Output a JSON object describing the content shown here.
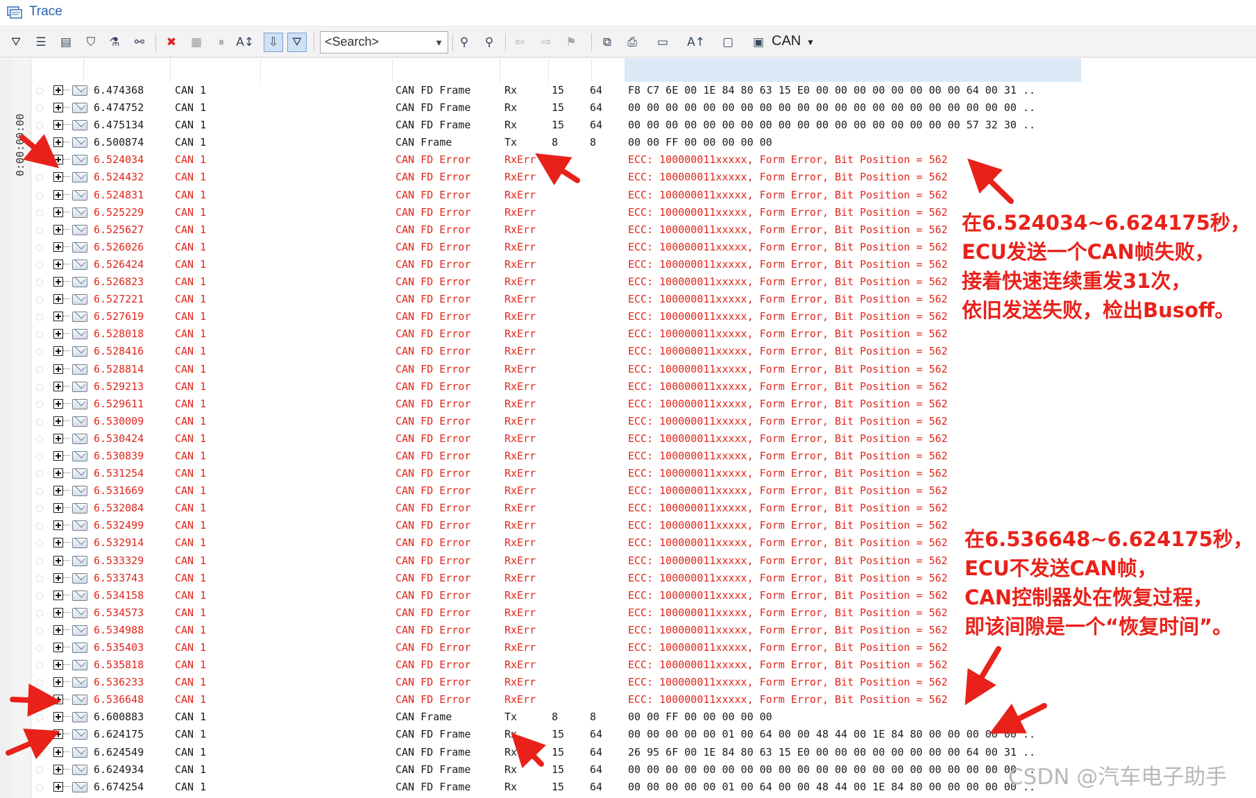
{
  "window": {
    "title": "Trace"
  },
  "toolbar": {
    "search_placeholder": "<Search>",
    "bus_label": "CAN"
  },
  "timebar": {
    "time": "0:00:00:00"
  },
  "trace_rows": [
    {
      "time": "6.474368",
      "channel": "CAN 1",
      "type": "CAN FD Frame",
      "dir": "Rx",
      "id": "15",
      "dlc": "64",
      "data": "F8 C7 6E 00 1E 84 80 63 15 E0 00 00 00 00 00 00 00 00 64 00 31  ..",
      "error": false
    },
    {
      "time": "6.474752",
      "channel": "CAN 1",
      "type": "CAN FD Frame",
      "dir": "Rx",
      "id": "15",
      "dlc": "64",
      "data": "00 00 00 00 00 00 00 00 00 00 00 00 00 00 00 00 00 00 00 00 00  ..",
      "error": false
    },
    {
      "time": "6.475134",
      "channel": "CAN 1",
      "type": "CAN FD Frame",
      "dir": "Rx",
      "id": "15",
      "dlc": "64",
      "data": "00 00 00 00 00 00 00 00 00 00 00 00 00 00 00 00 00 00 57 32 30  ..",
      "error": false
    },
    {
      "time": "6.500874",
      "channel": "CAN 1",
      "type": "CAN Frame",
      "dir": "Tx",
      "id": "8",
      "dlc": "8",
      "data": "00 00 FF 00 00 00 00 00",
      "error": false
    },
    {
      "time": "6.524034",
      "channel": "CAN 1",
      "type": "CAN FD Error",
      "dir": "RxErr",
      "id": "",
      "dlc": "",
      "data": "ECC: 100000011xxxxx, Form Error, Bit Position = 562",
      "error": true
    },
    {
      "time": "6.524432",
      "channel": "CAN 1",
      "type": "CAN FD Error",
      "dir": "RxErr",
      "id": "",
      "dlc": "",
      "data": "ECC: 100000011xxxxx, Form Error, Bit Position = 562",
      "error": true
    },
    {
      "time": "6.524831",
      "channel": "CAN 1",
      "type": "CAN FD Error",
      "dir": "RxErr",
      "id": "",
      "dlc": "",
      "data": "ECC: 100000011xxxxx, Form Error, Bit Position = 562",
      "error": true
    },
    {
      "time": "6.525229",
      "channel": "CAN 1",
      "type": "CAN FD Error",
      "dir": "RxErr",
      "id": "",
      "dlc": "",
      "data": "ECC: 100000011xxxxx, Form Error, Bit Position = 562",
      "error": true
    },
    {
      "time": "6.525627",
      "channel": "CAN 1",
      "type": "CAN FD Error",
      "dir": "RxErr",
      "id": "",
      "dlc": "",
      "data": "ECC: 100000011xxxxx, Form Error, Bit Position = 562",
      "error": true
    },
    {
      "time": "6.526026",
      "channel": "CAN 1",
      "type": "CAN FD Error",
      "dir": "RxErr",
      "id": "",
      "dlc": "",
      "data": "ECC: 100000011xxxxx, Form Error, Bit Position = 562",
      "error": true
    },
    {
      "time": "6.526424",
      "channel": "CAN 1",
      "type": "CAN FD Error",
      "dir": "RxErr",
      "id": "",
      "dlc": "",
      "data": "ECC: 100000011xxxxx, Form Error, Bit Position = 562",
      "error": true
    },
    {
      "time": "6.526823",
      "channel": "CAN 1",
      "type": "CAN FD Error",
      "dir": "RxErr",
      "id": "",
      "dlc": "",
      "data": "ECC: 100000011xxxxx, Form Error, Bit Position = 562",
      "error": true
    },
    {
      "time": "6.527221",
      "channel": "CAN 1",
      "type": "CAN FD Error",
      "dir": "RxErr",
      "id": "",
      "dlc": "",
      "data": "ECC: 100000011xxxxx, Form Error, Bit Position = 562",
      "error": true
    },
    {
      "time": "6.527619",
      "channel": "CAN 1",
      "type": "CAN FD Error",
      "dir": "RxErr",
      "id": "",
      "dlc": "",
      "data": "ECC: 100000011xxxxx, Form Error, Bit Position = 562",
      "error": true
    },
    {
      "time": "6.528018",
      "channel": "CAN 1",
      "type": "CAN FD Error",
      "dir": "RxErr",
      "id": "",
      "dlc": "",
      "data": "ECC: 100000011xxxxx, Form Error, Bit Position = 562",
      "error": true
    },
    {
      "time": "6.528416",
      "channel": "CAN 1",
      "type": "CAN FD Error",
      "dir": "RxErr",
      "id": "",
      "dlc": "",
      "data": "ECC: 100000011xxxxx, Form Error, Bit Position = 562",
      "error": true
    },
    {
      "time": "6.528814",
      "channel": "CAN 1",
      "type": "CAN FD Error",
      "dir": "RxErr",
      "id": "",
      "dlc": "",
      "data": "ECC: 100000011xxxxx, Form Error, Bit Position = 562",
      "error": true
    },
    {
      "time": "6.529213",
      "channel": "CAN 1",
      "type": "CAN FD Error",
      "dir": "RxErr",
      "id": "",
      "dlc": "",
      "data": "ECC: 100000011xxxxx, Form Error, Bit Position = 562",
      "error": true
    },
    {
      "time": "6.529611",
      "channel": "CAN 1",
      "type": "CAN FD Error",
      "dir": "RxErr",
      "id": "",
      "dlc": "",
      "data": "ECC: 100000011xxxxx, Form Error, Bit Position = 562",
      "error": true
    },
    {
      "time": "6.530009",
      "channel": "CAN 1",
      "type": "CAN FD Error",
      "dir": "RxErr",
      "id": "",
      "dlc": "",
      "data": "ECC: 100000011xxxxx, Form Error, Bit Position = 562",
      "error": true
    },
    {
      "time": "6.530424",
      "channel": "CAN 1",
      "type": "CAN FD Error",
      "dir": "RxErr",
      "id": "",
      "dlc": "",
      "data": "ECC: 100000011xxxxx, Form Error, Bit Position = 562",
      "error": true
    },
    {
      "time": "6.530839",
      "channel": "CAN 1",
      "type": "CAN FD Error",
      "dir": "RxErr",
      "id": "",
      "dlc": "",
      "data": "ECC: 100000011xxxxx, Form Error, Bit Position = 562",
      "error": true
    },
    {
      "time": "6.531254",
      "channel": "CAN 1",
      "type": "CAN FD Error",
      "dir": "RxErr",
      "id": "",
      "dlc": "",
      "data": "ECC: 100000011xxxxx, Form Error, Bit Position = 562",
      "error": true
    },
    {
      "time": "6.531669",
      "channel": "CAN 1",
      "type": "CAN FD Error",
      "dir": "RxErr",
      "id": "",
      "dlc": "",
      "data": "ECC: 100000011xxxxx, Form Error, Bit Position = 562",
      "error": true
    },
    {
      "time": "6.532084",
      "channel": "CAN 1",
      "type": "CAN FD Error",
      "dir": "RxErr",
      "id": "",
      "dlc": "",
      "data": "ECC: 100000011xxxxx, Form Error, Bit Position = 562",
      "error": true
    },
    {
      "time": "6.532499",
      "channel": "CAN 1",
      "type": "CAN FD Error",
      "dir": "RxErr",
      "id": "",
      "dlc": "",
      "data": "ECC: 100000011xxxxx, Form Error, Bit Position = 562",
      "error": true
    },
    {
      "time": "6.532914",
      "channel": "CAN 1",
      "type": "CAN FD Error",
      "dir": "RxErr",
      "id": "",
      "dlc": "",
      "data": "ECC: 100000011xxxxx, Form Error, Bit Position = 562",
      "error": true
    },
    {
      "time": "6.533329",
      "channel": "CAN 1",
      "type": "CAN FD Error",
      "dir": "RxErr",
      "id": "",
      "dlc": "",
      "data": "ECC: 100000011xxxxx, Form Error, Bit Position = 562",
      "error": true
    },
    {
      "time": "6.533743",
      "channel": "CAN 1",
      "type": "CAN FD Error",
      "dir": "RxErr",
      "id": "",
      "dlc": "",
      "data": "ECC: 100000011xxxxx, Form Error, Bit Position = 562",
      "error": true
    },
    {
      "time": "6.534158",
      "channel": "CAN 1",
      "type": "CAN FD Error",
      "dir": "RxErr",
      "id": "",
      "dlc": "",
      "data": "ECC: 100000011xxxxx, Form Error, Bit Position = 562",
      "error": true
    },
    {
      "time": "6.534573",
      "channel": "CAN 1",
      "type": "CAN FD Error",
      "dir": "RxErr",
      "id": "",
      "dlc": "",
      "data": "ECC: 100000011xxxxx, Form Error, Bit Position = 562",
      "error": true
    },
    {
      "time": "6.534988",
      "channel": "CAN 1",
      "type": "CAN FD Error",
      "dir": "RxErr",
      "id": "",
      "dlc": "",
      "data": "ECC: 100000011xxxxx, Form Error, Bit Position = 562",
      "error": true
    },
    {
      "time": "6.535403",
      "channel": "CAN 1",
      "type": "CAN FD Error",
      "dir": "RxErr",
      "id": "",
      "dlc": "",
      "data": "ECC: 100000011xxxxx, Form Error, Bit Position = 562",
      "error": true
    },
    {
      "time": "6.535818",
      "channel": "CAN 1",
      "type": "CAN FD Error",
      "dir": "RxErr",
      "id": "",
      "dlc": "",
      "data": "ECC: 100000011xxxxx, Form Error, Bit Position = 562",
      "error": true
    },
    {
      "time": "6.536233",
      "channel": "CAN 1",
      "type": "CAN FD Error",
      "dir": "RxErr",
      "id": "",
      "dlc": "",
      "data": "ECC: 100000011xxxxx, Form Error, Bit Position = 562",
      "error": true
    },
    {
      "time": "6.536648",
      "channel": "CAN 1",
      "type": "CAN FD Error",
      "dir": "RxErr",
      "id": "",
      "dlc": "",
      "data": "ECC: 100000011xxxxx, Form Error, Bit Position = 562",
      "error": true
    },
    {
      "time": "6.600883",
      "channel": "CAN 1",
      "type": "CAN Frame",
      "dir": "Tx",
      "id": "8",
      "dlc": "8",
      "data": "00 00 FF 00 00 00 00 00",
      "error": false
    },
    {
      "time": "6.624175",
      "channel": "CAN 1",
      "type": "CAN FD Frame",
      "dir": "Rx",
      "id": "15",
      "dlc": "64",
      "data": "00 00 00 00 00 01 00 64 00 00 48 44 00 1E 84 80 00 00 00 00 00  ..",
      "error": false
    },
    {
      "time": "6.624549",
      "channel": "CAN 1",
      "type": "CAN FD Frame",
      "dir": "Rx",
      "id": "15",
      "dlc": "64",
      "data": "26 95 6F 00 1E 84 80 63 15 E0 00 00 00 00 00 00 00 00 64 00 31  ..",
      "error": false
    },
    {
      "time": "6.624934",
      "channel": "CAN 1",
      "type": "CAN FD Frame",
      "dir": "Rx",
      "id": "15",
      "dlc": "64",
      "data": "00 00 00 00 00 00 00 00 00 00 00 00 00 00 00 00 00 00 00 00 00  ..",
      "error": false
    },
    {
      "time": "6.674254",
      "channel": "CAN 1",
      "type": "CAN FD Frame",
      "dir": "Rx",
      "id": "15",
      "dlc": "64",
      "data": "00 00 00 00 00 01 00 64 00 00 48 44 00 1E 84 80 00 00 00 00 00  ..",
      "error": false
    }
  ],
  "annotations": {
    "top": [
      "在6.524034~6.624175秒，",
      "ECU发送一个CAN帧失败，",
      "接着快速连续重发31次，",
      "依旧发送失败，检出Busoff。"
    ],
    "bottom": [
      "在6.536648~6.624175秒，",
      "ECU不发送CAN帧，",
      "CAN控制器处在恢复过程，",
      "即该间隙是一个“恢复时间”。"
    ]
  },
  "watermark": "CSDN @汽车电子助手",
  "colors": {
    "error_text": "#e0261c",
    "annotation": "#e8221a",
    "title": "#2a5fb0",
    "header_band": "#dbe9f7"
  },
  "icons": [
    "trace-window-icon",
    "expand-plus-icon",
    "message-envelope-icon",
    "delete-x-icon",
    "pause-icon",
    "binoculars-icon",
    "dropdown-arrow-icon"
  ]
}
